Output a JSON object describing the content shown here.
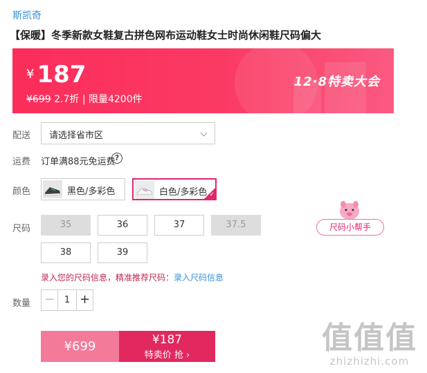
{
  "product": {
    "brand": "斯凯奇",
    "title": "【保暖】冬季新款女鞋复古拼色网布运动鞋女士时尚休闲鞋尺码偏大"
  },
  "price": {
    "currency": "¥",
    "current": "187",
    "original": "¥699",
    "discount": "2.7折",
    "separator": "|",
    "limit": "限量4200件",
    "event": "12·8特卖大会",
    "accent_color": "#fb2d5a"
  },
  "delivery": {
    "label": "配送",
    "placeholder": "请选择省市区"
  },
  "shipping": {
    "label": "运费",
    "text": "订单满88元免运费",
    "help_icon": "?"
  },
  "color": {
    "label": "颜色",
    "options": [
      {
        "label": "黑色/多彩色",
        "selected": false
      },
      {
        "label": "白色/多彩色",
        "selected": true
      }
    ],
    "selected_check": "✓",
    "selected_color": "#e0266e"
  },
  "size": {
    "label": "尺码",
    "options": [
      {
        "label": "35",
        "available": false
      },
      {
        "label": "36",
        "available": true
      },
      {
        "label": "37",
        "available": true
      },
      {
        "label": "37.5",
        "available": false
      },
      {
        "label": "38",
        "available": true
      },
      {
        "label": "39",
        "available": true
      }
    ],
    "helper_label": "尺码小帮手",
    "tip_prefix": "录入您的尺码信息，精准推荐尺码：",
    "tip_link": "录入尺码信息"
  },
  "quantity": {
    "label": "数量",
    "value": "1",
    "minus": "−",
    "plus": "+"
  },
  "buy": {
    "original_price": "¥699",
    "deal_price": "¥187",
    "cta": "特卖价 抢 ›"
  },
  "watermark": {
    "logo": "值值值",
    "domain": "zhizhizhi.com"
  }
}
